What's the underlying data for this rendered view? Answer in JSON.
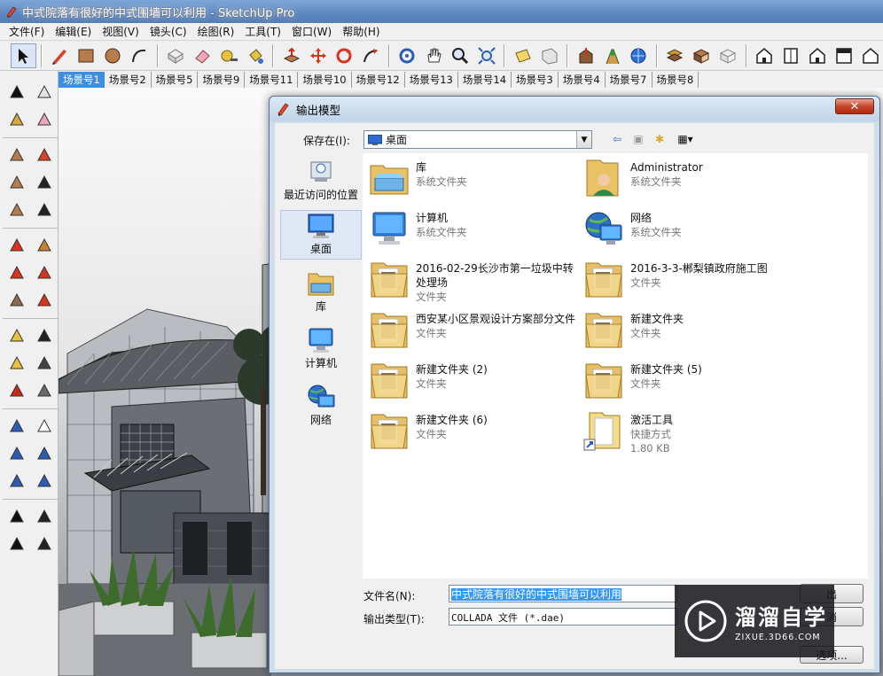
{
  "window": {
    "title": "中式院落有很好的中式围墙可以利用 - SketchUp Pro"
  },
  "menu": [
    "文件(F)",
    "编辑(E)",
    "视图(V)",
    "镜头(C)",
    "绘图(R)",
    "工具(T)",
    "窗口(W)",
    "帮助(H)"
  ],
  "toolbar": {
    "icons": [
      "select-icon",
      "pencil-icon",
      "rectangle-icon",
      "circle-icon",
      "arc-icon",
      "make-component-icon",
      "eraser-icon",
      "tape-measure-icon",
      "paint-bucket-icon",
      "push-pull-icon",
      "move-icon",
      "rotate-icon",
      "follow-me-icon",
      "orbit-icon",
      "pan-icon",
      "zoom-icon",
      "zoom-extents-icon",
      "section-plane-icon",
      "previous-view-icon",
      "warehouse-icon",
      "get-models-icon",
      "share-model-icon",
      "iso-view-icon",
      "top-view-icon",
      "front-view-icon",
      "right-view-icon",
      "back-view-icon",
      "left-view-icon"
    ]
  },
  "scenes": [
    "场景号1",
    "场景号2",
    "场景号5",
    "场景号9",
    "场景号11",
    "场景号10",
    "场景号12",
    "场景号13",
    "场景号14",
    "场景号3",
    "场景号4",
    "场景号7",
    "场景号8"
  ],
  "palette": [
    "select-icon",
    "make-component-icon",
    "paint-bucket-icon",
    "eraser-icon",
    "rectangle-icon",
    "line-icon",
    "circle-icon",
    "arc-icon",
    "polygon-icon",
    "freehand-icon",
    "move-icon",
    "push-pull-icon",
    "rotate-icon",
    "follow-me-icon",
    "scale-icon",
    "offset-icon",
    "tape-measure-icon",
    "dimension-icon",
    "protractor-icon",
    "text-icon",
    "axes-icon",
    "3d-text-icon",
    "orbit-icon",
    "pan-icon",
    "zoom-icon",
    "zoom-window-icon",
    "zoom-extents-icon",
    "previous-icon",
    "position-camera-icon",
    "look-around-icon",
    "walk-icon",
    "section-plane-icon"
  ],
  "dialog": {
    "title": "输出模型",
    "save_in_label": "保存在(I):",
    "save_in_value": "桌面",
    "places": [
      {
        "label": "最近访问的位置",
        "icon": "recent-places-icon"
      },
      {
        "label": "桌面",
        "icon": "desktop-icon"
      },
      {
        "label": "库",
        "icon": "libraries-icon"
      },
      {
        "label": "计算机",
        "icon": "computer-icon"
      },
      {
        "label": "网络",
        "icon": "network-icon"
      }
    ],
    "files": [
      {
        "name": "库",
        "type": "系统文件夹",
        "icon": "libraries-folder-icon"
      },
      {
        "name": "Administrator",
        "type": "系统文件夹",
        "icon": "user-folder-icon"
      },
      {
        "name": "计算机",
        "type": "系统文件夹",
        "icon": "computer-icon"
      },
      {
        "name": "网络",
        "type": "系统文件夹",
        "icon": "network-icon"
      },
      {
        "name": "2016-02-29长沙市第一垃圾中转处理场",
        "type": "文件夹",
        "icon": "folder-icon"
      },
      {
        "name": "2016-3-3-郴梨镇政府施工图",
        "type": "文件夹",
        "icon": "folder-icon"
      },
      {
        "name": "西安某小区景观设计方案部分文件",
        "type": "文件夹",
        "icon": "folder-icon"
      },
      {
        "name": "新建文件夹",
        "type": "文件夹",
        "icon": "folder-icon"
      },
      {
        "name": "新建文件夹 (2)",
        "type": "文件夹",
        "icon": "folder-icon"
      },
      {
        "name": "新建文件夹 (5)",
        "type": "文件夹",
        "icon": "folder-icon"
      },
      {
        "name": "新建文件夹 (6)",
        "type": "文件夹",
        "icon": "folder-icon"
      },
      {
        "name": "激活工具",
        "type": "快捷方式",
        "size": "1.80 KB",
        "icon": "shortcut-folder-icon"
      }
    ],
    "filename_label": "文件名(N):",
    "filename_value": "中式院落有很好的中式围墙可以利用",
    "filetype_label": "输出类型(T):",
    "filetype_value": "COLLADA 文件 (*.dae)",
    "buttons": {
      "ok": "出",
      "cancel": "消",
      "options": "选项..."
    }
  },
  "watermark": {
    "cn": "溜溜自学",
    "en": "ZIXUE.3D66.COM"
  }
}
